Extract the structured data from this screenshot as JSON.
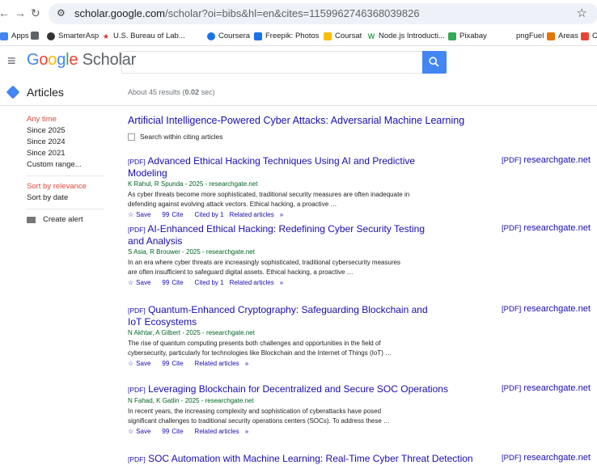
{
  "browser": {
    "url_host": "scholar.google.com",
    "url_path": "/scholar?oi=bibs&hl=en&cites=1159962746368039826"
  },
  "bookmarks": [
    {
      "label": "Apps",
      "icon": "apps-grid-icon",
      "color": "#fbbc05"
    },
    {
      "label": "",
      "icon": "grid-icon",
      "color": "#5f6368"
    },
    {
      "label": "SmarterAsp",
      "icon": "smarterasp-icon",
      "color": "#333333"
    },
    {
      "label": "U.S. Bureau of Lab...",
      "icon": "bls-icon",
      "color": "#d93025"
    },
    {
      "label": "Coursera",
      "icon": "coursera-icon",
      "color": "#1a73e8"
    },
    {
      "label": "Freepik: Photos",
      "icon": "freepik-icon",
      "color": "#1a73e8"
    },
    {
      "label": "Coursat",
      "icon": "coursat-icon",
      "color": "#fbbc05"
    },
    {
      "label": "Node.js Introducti...",
      "icon": "nodejs-icon",
      "color": "#34a853"
    },
    {
      "label": "Pixabay",
      "icon": "pixabay-icon",
      "color": "#34a853"
    },
    {
      "label": "pngFuel",
      "icon": "pngfuel-icon",
      "color": "#ffffff"
    },
    {
      "label": "Areas",
      "icon": "areas-icon",
      "color": "#e37400"
    },
    {
      "label": "Co",
      "icon": "co-icon",
      "color": "#ea4335"
    }
  ],
  "header": {
    "logo": "Google Scholar",
    "search_value": ""
  },
  "articles": {
    "label": "Articles",
    "results_prefix": "About 45 results (",
    "results_time": "0.02",
    "results_suffix": " sec)"
  },
  "sidebar": {
    "time_filters": [
      "Any time",
      "Since 2025",
      "Since 2024",
      "Since 2021",
      "Custom range..."
    ],
    "sort": [
      "Sort by relevance",
      "Sort by date"
    ],
    "create_alert": "Create alert"
  },
  "cited_article": {
    "title": "Artificial Intelligence-Powered Cyber Attacks: Adversarial Machine Learning",
    "search_within": "Search within citing articles"
  },
  "results": [
    {
      "pdf_tag": "[PDF]",
      "title": "Advanced Ethical Hacking Techniques Using AI and Predictive Modeling",
      "authors": "K Rahul, R Spunda - 2025 - researchgate.net",
      "snippet": "As cyber threats become more sophisticated, traditional security measures are often inadequate in defending against evolving attack vectors. Ethical hacking, a proactive …",
      "save": "Save",
      "cite": "Cite",
      "cited_by": "Cited by 1",
      "related": "Related articles",
      "side_tag": "[PDF]",
      "side_source": "researchgate.net"
    },
    {
      "pdf_tag": "[PDF]",
      "title": "AI-Enhanced Ethical Hacking: Redefining Cyber Security Testing and Analysis",
      "authors": "S Asia, R Brouwer - 2025 - researchgate.net",
      "snippet": "In an era where cyber threats are increasingly sophisticated, traditional cybersecurity measures are often insufficient to safeguard digital assets. Ethical hacking, a proactive …",
      "save": "Save",
      "cite": "Cite",
      "cited_by": "Cited by 1",
      "related": "Related articles",
      "side_tag": "[PDF]",
      "side_source": "researchgate.net"
    },
    {
      "pdf_tag": "[PDF]",
      "title": "Quantum-Enhanced Cryptography: Safeguarding Blockchain and IoT Ecosystems",
      "authors": "N Akhtar, A Gilbert - 2025 - researchgate.net",
      "snippet": "The rise of quantum computing presents both challenges and opportunities in the field of cybersecurity, particularly for technologies like Blockchain and the Internet of Things (IoT) …",
      "save": "Save",
      "cite": "Cite",
      "cited_by": "",
      "related": "Related articles",
      "side_tag": "[PDF]",
      "side_source": "researchgate.net"
    },
    {
      "pdf_tag": "[PDF]",
      "title": "Leveraging Blockchain for Decentralized and Secure SOC Operations",
      "authors": "N Fahad, K Gatlin - 2025 - researchgate.net",
      "snippet": "In recent years, the increasing complexity and sophistication of cyberattacks have posed significant challenges to traditional security operations centers (SOCs). To address these …",
      "save": "Save",
      "cite": "Cite",
      "cited_by": "",
      "related": "Related articles",
      "side_tag": "[PDF]",
      "side_source": "researchgate.net"
    },
    {
      "pdf_tag": "[PDF]",
      "title": "SOC Automation with Machine Learning: Real-Time Cyber Threat Detection",
      "authors": "",
      "snippet": "",
      "save": "",
      "cite": "",
      "cited_by": "",
      "related": "",
      "side_tag": "[PDF]",
      "side_source": "researchgate.net"
    }
  ]
}
